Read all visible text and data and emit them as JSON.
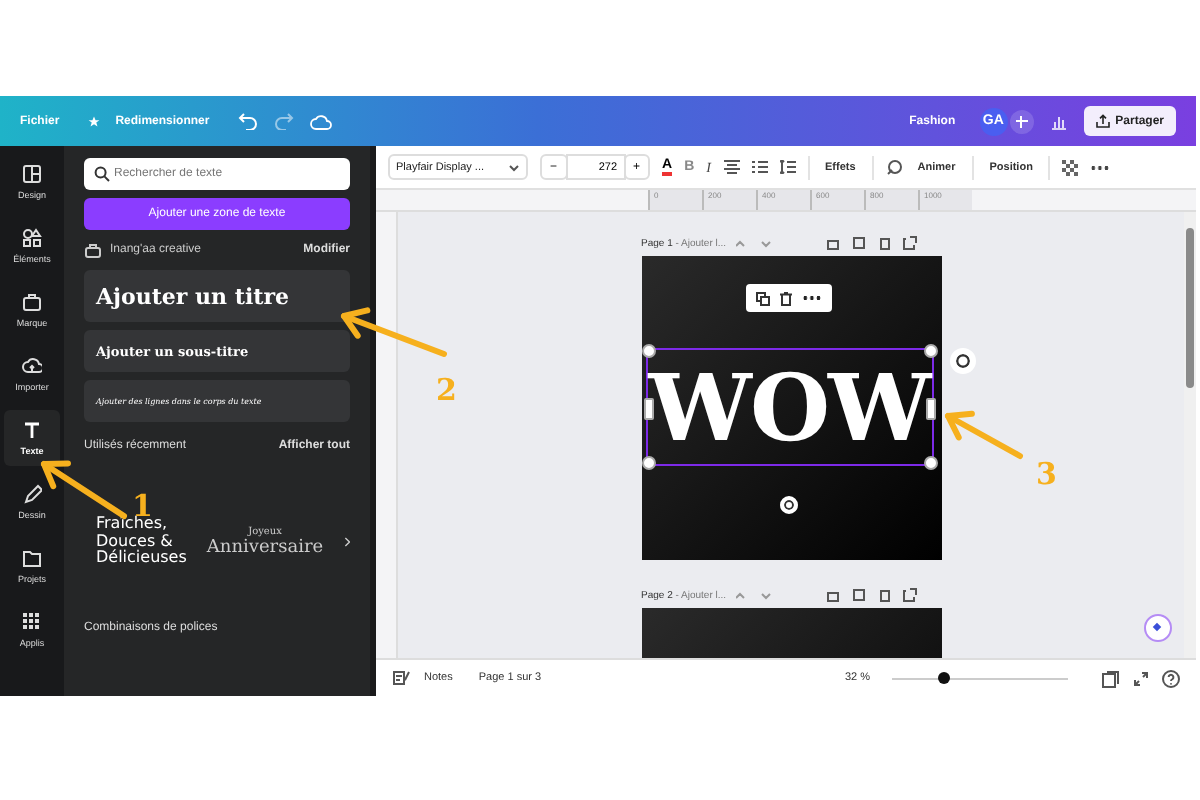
{
  "top_bar": {
    "menu": [
      {
        "label": "Fichier",
        "kind": "plain"
      },
      {
        "label": "Redimensionner",
        "kind": "star"
      }
    ],
    "project": "Fashion",
    "avatar": "GA",
    "share": "Partager"
  },
  "rail": [
    {
      "label": "Design",
      "selected": false
    },
    {
      "label": "Éléments",
      "selected": false
    },
    {
      "label": "Marque",
      "selected": false
    },
    {
      "label": "Importer",
      "selected": false
    },
    {
      "label": "Texte",
      "selected": true
    },
    {
      "label": "Dessin",
      "selected": false
    },
    {
      "label": "Projets",
      "selected": false
    },
    {
      "label": "Applis",
      "selected": false
    }
  ],
  "panel": {
    "search": {
      "placeholder": "Rechercher de texte"
    },
    "add_button": "Ajouter une zone de texte",
    "brand_kit": {
      "name": "Inang'aa creative",
      "action": "Modifier"
    },
    "text_styles": [
      {
        "kind": "title",
        "text": "Ajouter un titre"
      },
      {
        "kind": "subtitle",
        "text": "Ajouter un sous-titre"
      },
      {
        "kind": "body",
        "text": "Ajouter des lignes dans le corps du texte"
      }
    ],
    "recent": {
      "heading": "Utilisés récemment",
      "action": "Afficher tout",
      "items": [
        {
          "kind": "stack",
          "lines": [
            "Fraîches,",
            "Douces &",
            "Délicieuses"
          ]
        },
        {
          "kind": "greeting",
          "lines": [
            "Joyeux",
            "Anniversaire"
          ]
        }
      ]
    },
    "combos_heading": "Combinaisons de polices"
  },
  "toolbar": {
    "font": "Playfair Display ...",
    "minus": "−",
    "size": "272",
    "plus": "+",
    "bold": "B",
    "italic": "I",
    "color_letter": "A",
    "buttons": [
      "Effets",
      "Animer",
      "Position"
    ]
  },
  "ruler": [
    "0",
    "200",
    "400",
    "600",
    "800",
    "1000"
  ],
  "pages": [
    {
      "label": "Page 1",
      "title": "- Ajouter l...",
      "text_box": {
        "text": "WOW",
        "selected": true
      }
    },
    {
      "label": "Page 2",
      "title": "- Ajouter l..."
    }
  ],
  "bottom_bar": {
    "notes": "Notes",
    "page_info": "Page 1 sur 3",
    "zoom": "32 %",
    "level": 0.3
  },
  "annotations": [
    {
      "number": "1"
    },
    {
      "number": "2"
    },
    {
      "number": "3"
    }
  ]
}
